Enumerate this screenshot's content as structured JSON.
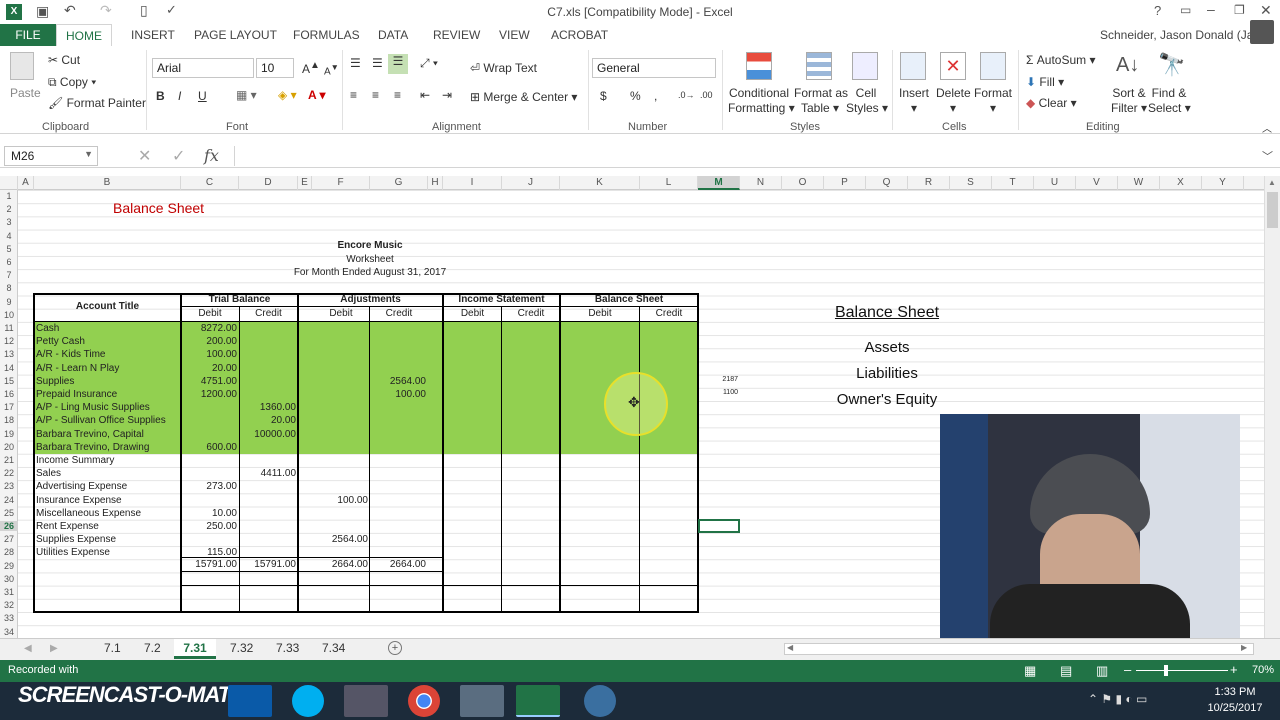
{
  "window": {
    "title": "C7.xls  [Compatibility Mode] - Excel",
    "user": "Schneider, Jason Donald (Jay)"
  },
  "ribbon_tabs": [
    "FILE",
    "HOME",
    "INSERT",
    "PAGE LAYOUT",
    "FORMULAS",
    "DATA",
    "REVIEW",
    "VIEW",
    "ACROBAT"
  ],
  "ribbon": {
    "clipboard": {
      "paste": "Paste",
      "cut": "Cut",
      "copy": "Copy",
      "format_painter": "Format Painter",
      "label": "Clipboard"
    },
    "font": {
      "name": "Arial",
      "size": "10",
      "label": "Font",
      "bold": "B",
      "italic": "I",
      "underline": "U"
    },
    "alignment": {
      "wrap": "Wrap Text",
      "merge": "Merge & Center",
      "label": "Alignment"
    },
    "number": {
      "format": "General",
      "label": "Number",
      "currency": "$",
      "percent": "%",
      "comma": ","
    },
    "styles": {
      "conditional": "Conditional",
      "conditional2": "Formatting",
      "format_as": "Format as",
      "format_as2": "Table",
      "cell": "Cell",
      "cell2": "Styles",
      "label": "Styles"
    },
    "cells": {
      "insert": "Insert",
      "delete": "Delete",
      "format": "Format",
      "label": "Cells"
    },
    "editing": {
      "autosum": "AutoSum",
      "fill": "Fill",
      "clear": "Clear",
      "sort": "Sort &",
      "sort2": "Filter",
      "find": "Find &",
      "find2": "Select",
      "label": "Editing"
    }
  },
  "formula_bar": {
    "name_box": "M26",
    "fx": "fx",
    "value": ""
  },
  "columns": [
    "A",
    "B",
    "C",
    "D",
    "E",
    "F",
    "G",
    "H",
    "I",
    "J",
    "K",
    "L",
    "M",
    "N",
    "O",
    "P",
    "Q",
    "R",
    "S",
    "T",
    "U",
    "V",
    "W",
    "X",
    "Y"
  ],
  "rows": [
    "1",
    "2",
    "3",
    "4",
    "5",
    "6",
    "7",
    "8",
    "9",
    "10",
    "11",
    "12",
    "13",
    "14",
    "15",
    "16",
    "17",
    "18",
    "19",
    "20",
    "21",
    "22",
    "23",
    "24",
    "25",
    "26",
    "27",
    "28",
    "29",
    "30",
    "31",
    "32",
    "33",
    "34"
  ],
  "sheet": {
    "balance_sheet_title": "Balance Sheet",
    "company": "Encore Music",
    "doc": "Worksheet",
    "period": "For Month Ended August 31, 2017",
    "headers": {
      "account_title": "Account Title",
      "trial_balance": "Trial Balance",
      "adjustments": "Adjustments",
      "income_statement": "Income Statement",
      "balance_sheet": "Balance Sheet",
      "debit": "Debit",
      "credit": "Credit"
    },
    "accounts": [
      {
        "name": "Cash",
        "tb_debit": "8272.00",
        "tb_credit": "",
        "adj_debit": "",
        "adj_credit": ""
      },
      {
        "name": "Petty Cash",
        "tb_debit": "200.00",
        "tb_credit": "",
        "adj_debit": "",
        "adj_credit": ""
      },
      {
        "name": "A/R - Kids Time",
        "tb_debit": "100.00",
        "tb_credit": "",
        "adj_debit": "",
        "adj_credit": ""
      },
      {
        "name": "A/R - Learn N Play",
        "tb_debit": "20.00",
        "tb_credit": "",
        "adj_debit": "",
        "adj_credit": ""
      },
      {
        "name": "Supplies",
        "tb_debit": "4751.00",
        "tb_credit": "",
        "adj_debit": "",
        "adj_credit": "2564.00"
      },
      {
        "name": "Prepaid Insurance",
        "tb_debit": "1200.00",
        "tb_credit": "",
        "adj_debit": "",
        "adj_credit": "100.00"
      },
      {
        "name": "A/P - Ling Music Supplies",
        "tb_debit": "",
        "tb_credit": "1360.00",
        "adj_debit": "",
        "adj_credit": ""
      },
      {
        "name": "A/P - Sullivan Office Supplies",
        "tb_debit": "",
        "tb_credit": "20.00",
        "adj_debit": "",
        "adj_credit": ""
      },
      {
        "name": "Barbara Trevino, Capital",
        "tb_debit": "",
        "tb_credit": "10000.00",
        "adj_debit": "",
        "adj_credit": ""
      },
      {
        "name": "Barbara Trevino, Drawing",
        "tb_debit": "600.00",
        "tb_credit": "",
        "adj_debit": "",
        "adj_credit": ""
      },
      {
        "name": "Income Summary",
        "tb_debit": "",
        "tb_credit": "",
        "adj_debit": "",
        "adj_credit": ""
      },
      {
        "name": "Sales",
        "tb_debit": "",
        "tb_credit": "4411.00",
        "adj_debit": "",
        "adj_credit": ""
      },
      {
        "name": "Advertising Expense",
        "tb_debit": "273.00",
        "tb_credit": "",
        "adj_debit": "",
        "adj_credit": ""
      },
      {
        "name": "Insurance Expense",
        "tb_debit": "",
        "tb_credit": "",
        "adj_debit": "100.00",
        "adj_credit": ""
      },
      {
        "name": "Miscellaneous Expense",
        "tb_debit": "10.00",
        "tb_credit": "",
        "adj_debit": "",
        "adj_credit": ""
      },
      {
        "name": "Rent Expense",
        "tb_debit": "250.00",
        "tb_credit": "",
        "adj_debit": "",
        "adj_credit": ""
      },
      {
        "name": "Supplies Expense",
        "tb_debit": "",
        "tb_credit": "",
        "adj_debit": "2564.00",
        "adj_credit": ""
      },
      {
        "name": "Utilities Expense",
        "tb_debit": "115.00",
        "tb_credit": "",
        "adj_debit": "",
        "adj_credit": ""
      }
    ],
    "totals": {
      "tb_debit": "15791.00",
      "tb_credit": "15791.00",
      "adj_debit": "2664.00",
      "adj_credit": "2664.00"
    },
    "side_notes": {
      "m15": "2187",
      "m16": "1100"
    },
    "right_panel": {
      "title": "Balance Sheet",
      "assets": "Assets",
      "liabilities": "Liabilities",
      "equity": "Owner's Equity"
    }
  },
  "sheet_tabs": [
    "7.1",
    "7.2",
    "7.31",
    "7.32",
    "7.33",
    "7.34"
  ],
  "active_tab": "7.31",
  "status": {
    "left": "Recorded with",
    "zoom": "70%"
  },
  "watermark": "SCREENCAST-O-MATIC",
  "clock": {
    "time": "1:33 PM",
    "date": "10/25/2017"
  }
}
